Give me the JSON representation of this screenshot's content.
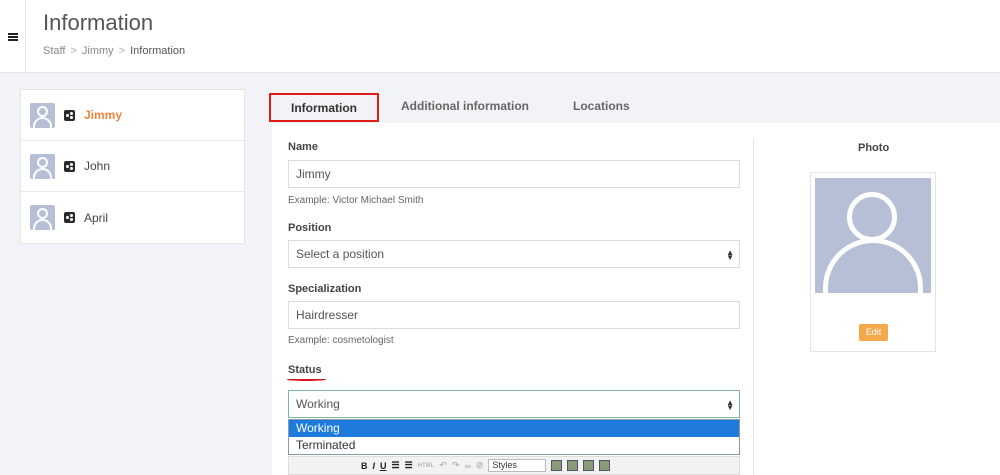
{
  "header": {
    "title": "Information",
    "breadcrumb": [
      "Staff",
      "Jimmy",
      "Information"
    ],
    "separator": ">"
  },
  "staff": [
    {
      "name": "Jimmy",
      "active": true
    },
    {
      "name": "John",
      "active": false
    },
    {
      "name": "April",
      "active": false
    }
  ],
  "tabs": [
    "Information",
    "Additional information",
    "Locations"
  ],
  "form": {
    "name_label": "Name",
    "name_value": "Jimmy",
    "name_hint": "Example: Victor Michael Smith",
    "position_label": "Position",
    "position_value": "Select a position",
    "specialization_label": "Specialization",
    "specialization_value": "Hairdresser",
    "specialization_hint": "Example: cosmetologist",
    "status_label": "Status",
    "status_value": "Working",
    "status_options": [
      "Working",
      "Terminated"
    ]
  },
  "editor_toolbar": {
    "bold": "B",
    "italic": "I",
    "underline": "U",
    "html": "HTML",
    "styles": "Styles"
  },
  "photo": {
    "title": "Photo",
    "edit_label": "Edit"
  },
  "colors": {
    "accent": "#f0843c",
    "highlight_box": "#e01b1b",
    "selected_option": "#1e7bdc",
    "edit_button": "#f5a84a"
  }
}
